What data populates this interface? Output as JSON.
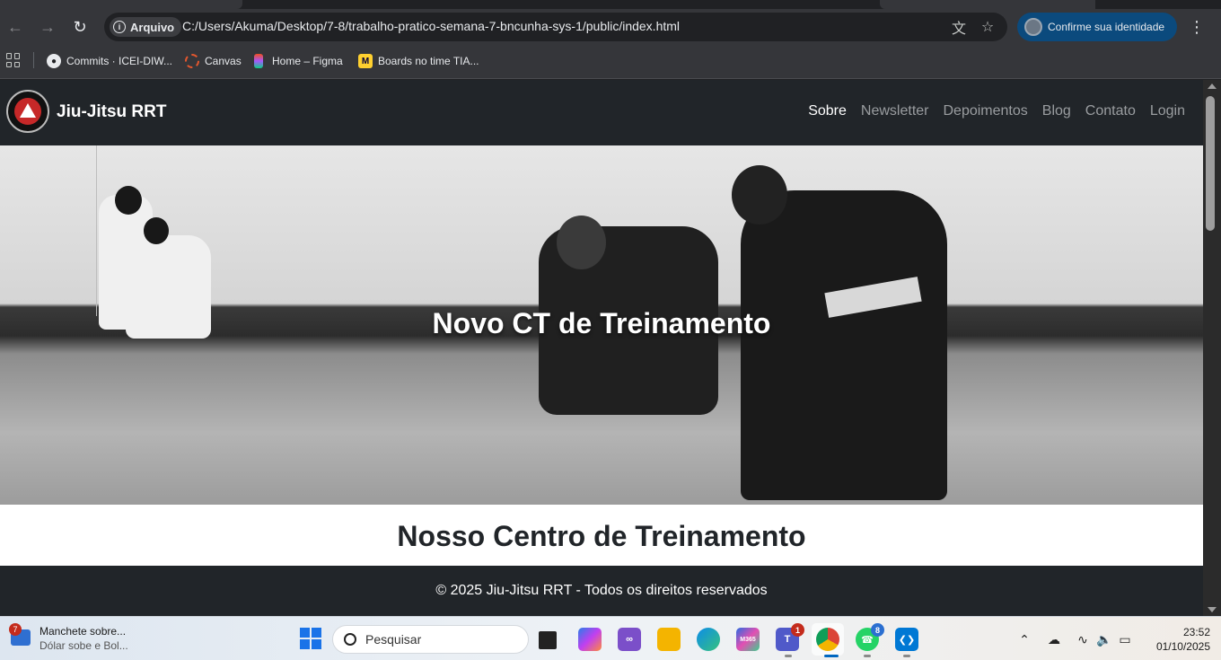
{
  "browser": {
    "site_chip": "Arquivo",
    "url": "C:/Users/Akuma/Desktop/7-8/trabalho-pratico-semana-7-bncunha-sys-1/public/index.html",
    "identity_button": "Confirme sua identidade",
    "bookmarks": [
      {
        "label": "Commits · ICEI-DIW...",
        "icon": "github-icon"
      },
      {
        "label": "Canvas",
        "icon": "canvas-icon"
      },
      {
        "label": "Home – Figma",
        "icon": "figma-icon"
      },
      {
        "label": "Boards no time TIA...",
        "icon": "miro-icon"
      }
    ]
  },
  "site": {
    "brand": "Jiu-Jitsu RRT",
    "nav": [
      "Sobre",
      "Newsletter",
      "Depoimentos",
      "Blog",
      "Contato",
      "Login"
    ],
    "active_nav": "Sobre",
    "hero_title": "Novo CT de Treinamento",
    "section_title": "Nosso Centro de Treinamento",
    "footer": "© 2025 Jiu-Jitsu RRT - Todos os direitos reservados"
  },
  "taskbar": {
    "news_badge": "7",
    "news_title": "Manchete sobre...",
    "news_subtitle": "Dólar sobe e Bol...",
    "search_placeholder": "Pesquisar",
    "teams_badge": "1",
    "whatsapp_badge": "8",
    "time": "23:52",
    "date": "01/10/2025"
  },
  "colors": {
    "navbar": "#212529",
    "identity": "#0b4a7d",
    "accent": "#1a73e8"
  }
}
